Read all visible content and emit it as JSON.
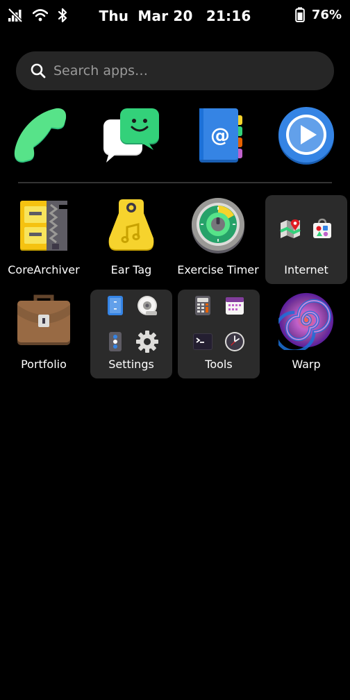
{
  "status_bar": {
    "day": "Thu",
    "date": "Mar 20",
    "time": "21:16",
    "battery_percent": "76%",
    "icons": [
      "no-signal-icon",
      "wifi-icon",
      "bluetooth-icon",
      "battery-icon"
    ]
  },
  "search": {
    "placeholder": "Search apps…"
  },
  "favorites": [
    {
      "name": "phone",
      "icon": "phone-icon"
    },
    {
      "name": "chat",
      "icon": "chat-icon"
    },
    {
      "name": "contacts",
      "icon": "contacts-icon"
    },
    {
      "name": "video-player",
      "icon": "play-icon"
    }
  ],
  "apps": [
    {
      "label": "CoreArchiver",
      "icon": "archive-icon"
    },
    {
      "label": "Ear Tag",
      "icon": "ear-tag-icon"
    },
    {
      "label": "Exercise Timer",
      "icon": "timer-icon"
    },
    {
      "label": "Internet",
      "icon": "folder-icon",
      "folder": true
    },
    {
      "label": "Portfolio",
      "icon": "briefcase-icon"
    },
    {
      "label": "Settings",
      "icon": "folder-icon",
      "folder": true
    },
    {
      "label": "Tools",
      "icon": "folder-icon",
      "folder": true
    },
    {
      "label": "Warp",
      "icon": "warp-icon"
    }
  ],
  "colors": {
    "background": "#000000",
    "search_bg": "#262626",
    "folder_bg": "#2b2b2b",
    "phone_green": "#33d17a",
    "accent_blue": "#3584e4"
  }
}
